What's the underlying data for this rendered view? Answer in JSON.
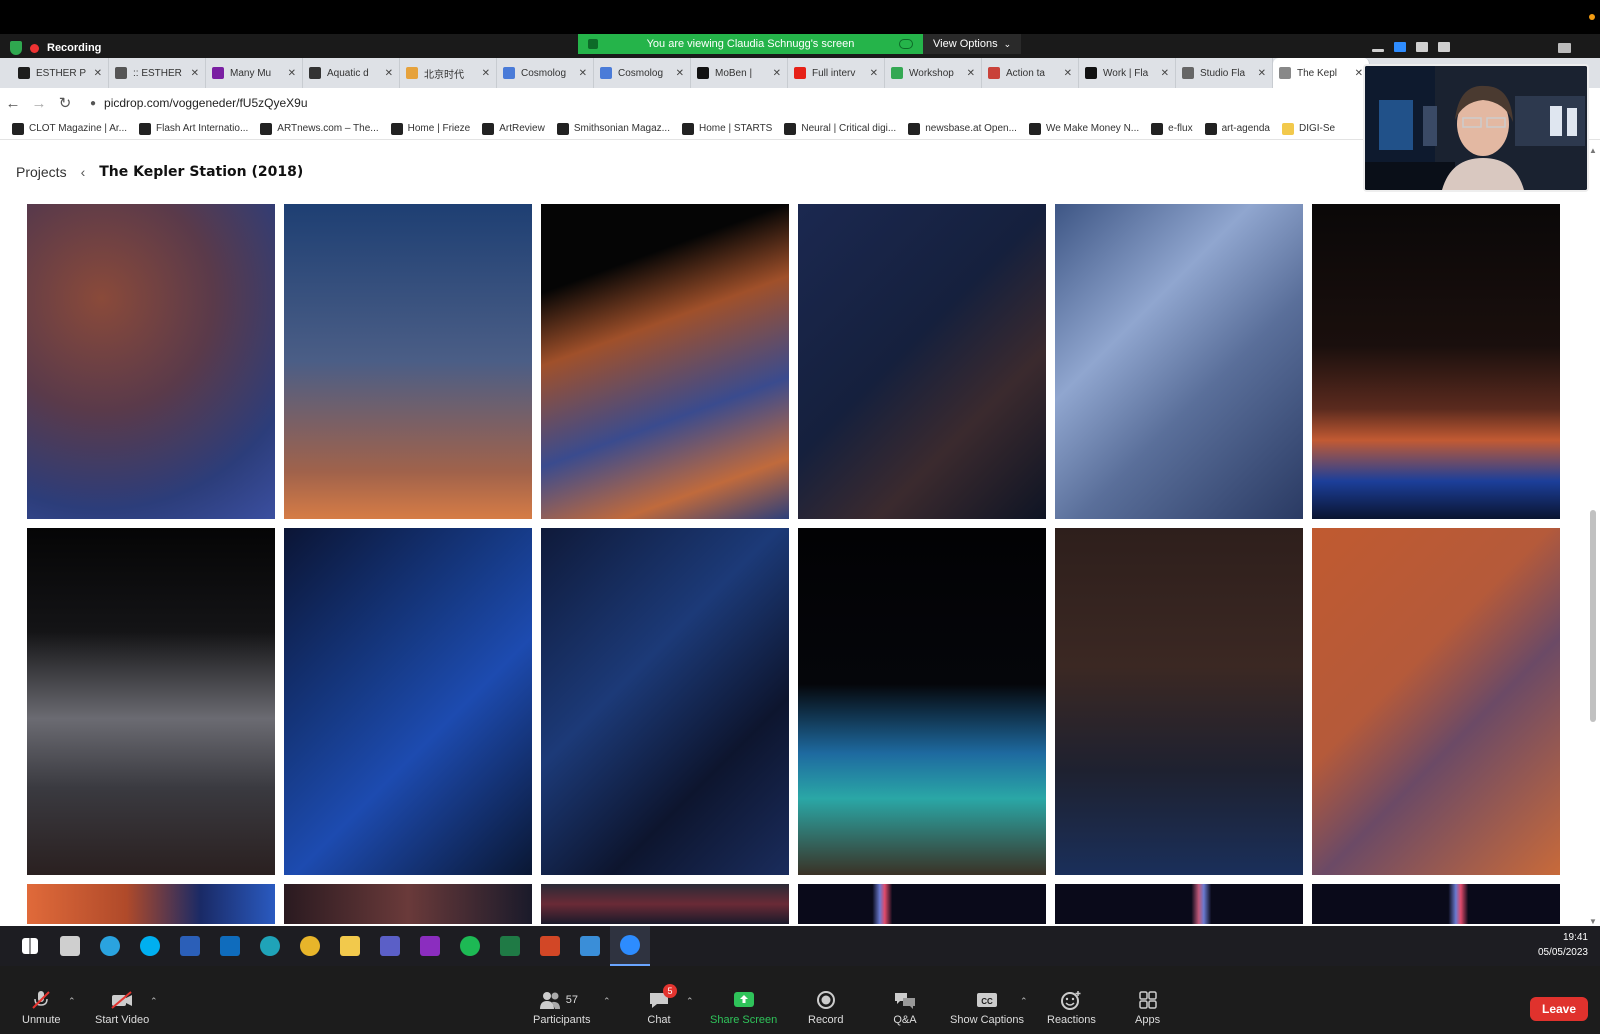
{
  "zoom": {
    "recording_label": "Recording",
    "viewing_banner": "You are viewing Claudia Schnugg's screen",
    "view_options_label": "View Options",
    "controls": {
      "unmute": "Unmute",
      "start_video": "Start Video",
      "participants": "Participants",
      "participants_count": "57",
      "chat": "Chat",
      "chat_badge": "5",
      "share_screen": "Share Screen",
      "record": "Record",
      "qa": "Q&A",
      "show_captions": "Show Captions",
      "reactions": "Reactions",
      "apps": "Apps",
      "leave": "Leave"
    }
  },
  "browser": {
    "tabs": [
      {
        "label": "ESTHER P",
        "color": "#1d1d1d"
      },
      {
        "label": ":: ESTHER",
        "color": "#555555"
      },
      {
        "label": "Many Mu",
        "color": "#7a1fa2"
      },
      {
        "label": "Aquatic d",
        "color": "#333333"
      },
      {
        "label": "北京时代",
        "color": "#e6a23c"
      },
      {
        "label": "Cosmolog",
        "color": "#4a7bd8"
      },
      {
        "label": "Cosmolog",
        "color": "#4a7bd8"
      },
      {
        "label": "MoBen |",
        "color": "#111111"
      },
      {
        "label": "Full interv",
        "color": "#e62117"
      },
      {
        "label": "Workshop",
        "color": "#34a853"
      },
      {
        "label": "Action ta",
        "color": "#c9423a"
      },
      {
        "label": "Work | Fla",
        "color": "#111111"
      },
      {
        "label": "Studio Fla",
        "color": "#666666"
      },
      {
        "label": "The Kepl",
        "color": "#888888"
      }
    ],
    "url": "picdrop.com/voggeneder/fU5zQyeX9u",
    "bookmarks": [
      {
        "label": "CLOT Magazine | Ar...",
        "icon": "CLOT"
      },
      {
        "label": "Flash Art Internatio...",
        "icon": "FA"
      },
      {
        "label": "ARTnews.com – The...",
        "icon": "AN"
      },
      {
        "label": "Home | Frieze",
        "icon": "F"
      },
      {
        "label": "ArtReview",
        "icon": "AR"
      },
      {
        "label": "Smithsonian Magaz...",
        "icon": "S"
      },
      {
        "label": "Home | STARTS",
        "icon": "S"
      },
      {
        "label": "Neural | Critical digi...",
        "icon": "N"
      },
      {
        "label": "newsbase.at Open...",
        "icon": "N"
      },
      {
        "label": "We Make Money N...",
        "icon": "W"
      },
      {
        "label": "e-flux",
        "icon": "e"
      },
      {
        "label": "art-agenda",
        "icon": "a"
      },
      {
        "label": "DIGI-Se",
        "icon": "folder"
      }
    ]
  },
  "page": {
    "breadcrumb_root": "Projects",
    "title": "The Kepler Station (2018)"
  },
  "photos": [
    {
      "name": "red-blue-terrain-texture",
      "bg": "radial-gradient(circle at 30% 30%, #8a4a3a 0%, #5a3a4a 40%, #2c3d7a 75%, #3b4fa0 100%)"
    },
    {
      "name": "satellite-dish-at-sunset",
      "bg": "linear-gradient(180deg, #1e3f73 0%, #4b5e86 50%, #a0624b 85%, #d67c46 100%)"
    },
    {
      "name": "rocky-hill-blue-orange",
      "bg": "linear-gradient(160deg, #050505 0%, #050505 22%, #a0502a 40%, #3a4b8e 65%, #c06a3c 85%, #2d3f7a 100%)"
    },
    {
      "name": "portrait-profile-dark",
      "bg": "linear-gradient(135deg, #1b2850 0%, #15203d 45%, #3b2a2e 70%, #0e1424 100%)"
    },
    {
      "name": "spacesuit-tubes-detail",
      "bg": "linear-gradient(135deg, #3e5685 0%, #90a6cf 35%, #5a6f9a 60%, #2a3a63 100%)"
    },
    {
      "name": "dome-station-night",
      "bg": "linear-gradient(180deg, #0a0808 0%, #1a0f0d 45%, #5a2a1e 65%, #c25a33 75%, #1c3f9a 88%, #0a1430 100%)"
    },
    {
      "name": "astronaut-corridor",
      "bg": "linear-gradient(180deg, #050506 0%, #141416 30%, #6b6b72 55%, #3a3a40 75%, #2a2020 100%)"
    },
    {
      "name": "light-trails-machinery",
      "bg": "linear-gradient(135deg, #0b1535 0%, #163a86 40%, #1d4bb0 60%, #0a1733 100%)"
    },
    {
      "name": "woman-blue-light",
      "bg": "linear-gradient(135deg, #0f1a3a 0%, #1c3a78 40%, #0d152e 70%, #1a2c5c 100%)"
    },
    {
      "name": "glowing-dome-field",
      "bg": "linear-gradient(180deg, #020204 0%, #05060a 45%, #1e6aa0 65%, #2aa7a6 78%, #3a3226 100%)"
    },
    {
      "name": "two-astronauts-dome",
      "bg": "linear-gradient(180deg, #2e1f1c 0%, #3b2823 40%, #1e2130 70%, #1a2f5a 100%)"
    },
    {
      "name": "martian-rocks-object",
      "bg": "linear-gradient(135deg, #c05a30 0%, #b55a3a 40%, #6b4a66 60%, #c86a3a 100%)"
    },
    {
      "name": "partial-photo-1",
      "bg": "linear-gradient(90deg, #e06a3a 0%, #b04a2a 40%, #1a2a66 70%, #2a5ac0 100%)"
    },
    {
      "name": "partial-photo-2",
      "bg": "linear-gradient(90deg, #2a1a20 0%, #6a3a3a 50%, #1a1a2a 100%)"
    },
    {
      "name": "partial-photo-3",
      "bg": "linear-gradient(180deg, #2a2a36 0%, #6a2a36 50%, #1a1a2a 100%)"
    },
    {
      "name": "partial-photo-4",
      "bg": "linear-gradient(90deg, #0a0a1a 0%, #0a0a1a 30%, #6a7ad0 33%, #e04a6a 35%, #0a0a1a 38%, #0a0a1a 100%)"
    },
    {
      "name": "partial-photo-5",
      "bg": "linear-gradient(90deg, #0a0a1a 0%, #0a0a1a 55%, #c05a7a 58%, #6a7ad0 60%, #0a0a1a 63%, #0a0a1a 100%)"
    },
    {
      "name": "partial-photo-6",
      "bg": "linear-gradient(90deg, #0a0a1a 0%, #0a0a1a 55%, #6a7ad0 58%, #e04a6a 60%, #0a0a1a 63%, #0a0a1a 100%)"
    }
  ],
  "taskbar": {
    "apps": [
      {
        "name": "windows-start-icon",
        "color": "#ffffff"
      },
      {
        "name": "task-view-icon",
        "color": "#cfcfcf"
      },
      {
        "name": "telegram-icon",
        "color": "#2aa3df"
      },
      {
        "name": "skype-icon",
        "color": "#00aff0"
      },
      {
        "name": "word-icon",
        "color": "#2b5fb8"
      },
      {
        "name": "outlook-icon",
        "color": "#0f6cbd"
      },
      {
        "name": "edge-icon",
        "color": "#1fa3b8"
      },
      {
        "name": "chrome-icon",
        "color": "#e8b52a"
      },
      {
        "name": "file-explorer-icon",
        "color": "#f2c94c"
      },
      {
        "name": "teams-icon",
        "color": "#5b5fc7"
      },
      {
        "name": "onenote-icon",
        "color": "#8b2dbf"
      },
      {
        "name": "spotify-icon",
        "color": "#1db954"
      },
      {
        "name": "excel-icon",
        "color": "#1f7a45"
      },
      {
        "name": "powerpoint-icon",
        "color": "#d24726"
      },
      {
        "name": "photos-icon",
        "color": "#3a8ed8"
      },
      {
        "name": "zoom-icon",
        "color": "#2d8cff"
      }
    ],
    "time": "19:41",
    "date": "05/05/2023"
  }
}
